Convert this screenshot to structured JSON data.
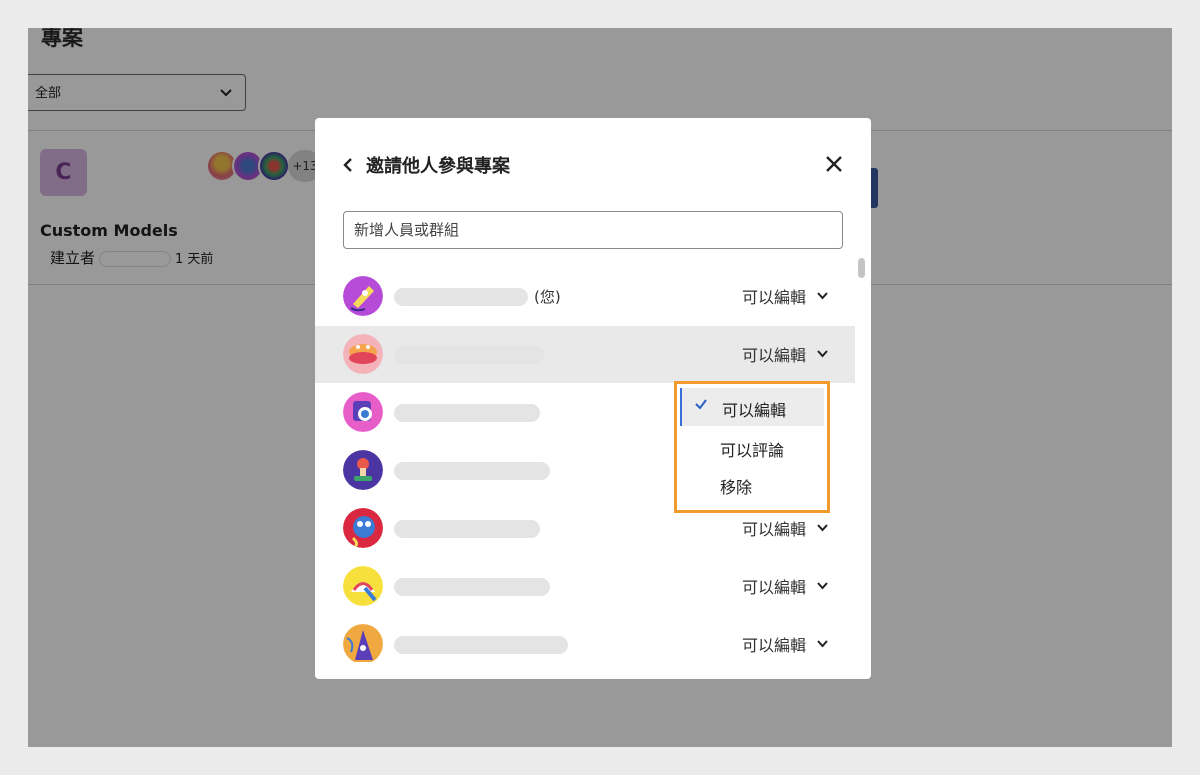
{
  "background": {
    "title": "專案",
    "filter": {
      "value": "全部"
    },
    "project": {
      "badge_letter": "C",
      "extra_members": "+13",
      "name": "Custom Models",
      "created_by_label": "建立者",
      "time_ago": "1 天前"
    }
  },
  "modal": {
    "title": "邀請他人參與專案",
    "input_placeholder": "新增人員或群組",
    "you_label": "(您)",
    "members": [
      {
        "role": "可以編輯",
        "is_you": true
      },
      {
        "role": "可以編輯",
        "hovered": true
      },
      {
        "role": ""
      },
      {
        "role": ""
      },
      {
        "role": "可以編輯"
      },
      {
        "role": "可以編輯"
      },
      {
        "role": "可以編輯"
      }
    ],
    "role_menu": {
      "options": [
        "可以編輯",
        "可以評論",
        "移除"
      ],
      "selected": "可以編輯"
    }
  },
  "colors": {
    "highlight_border": "#f29a2e",
    "selected_accent": "#3a6fd9"
  }
}
